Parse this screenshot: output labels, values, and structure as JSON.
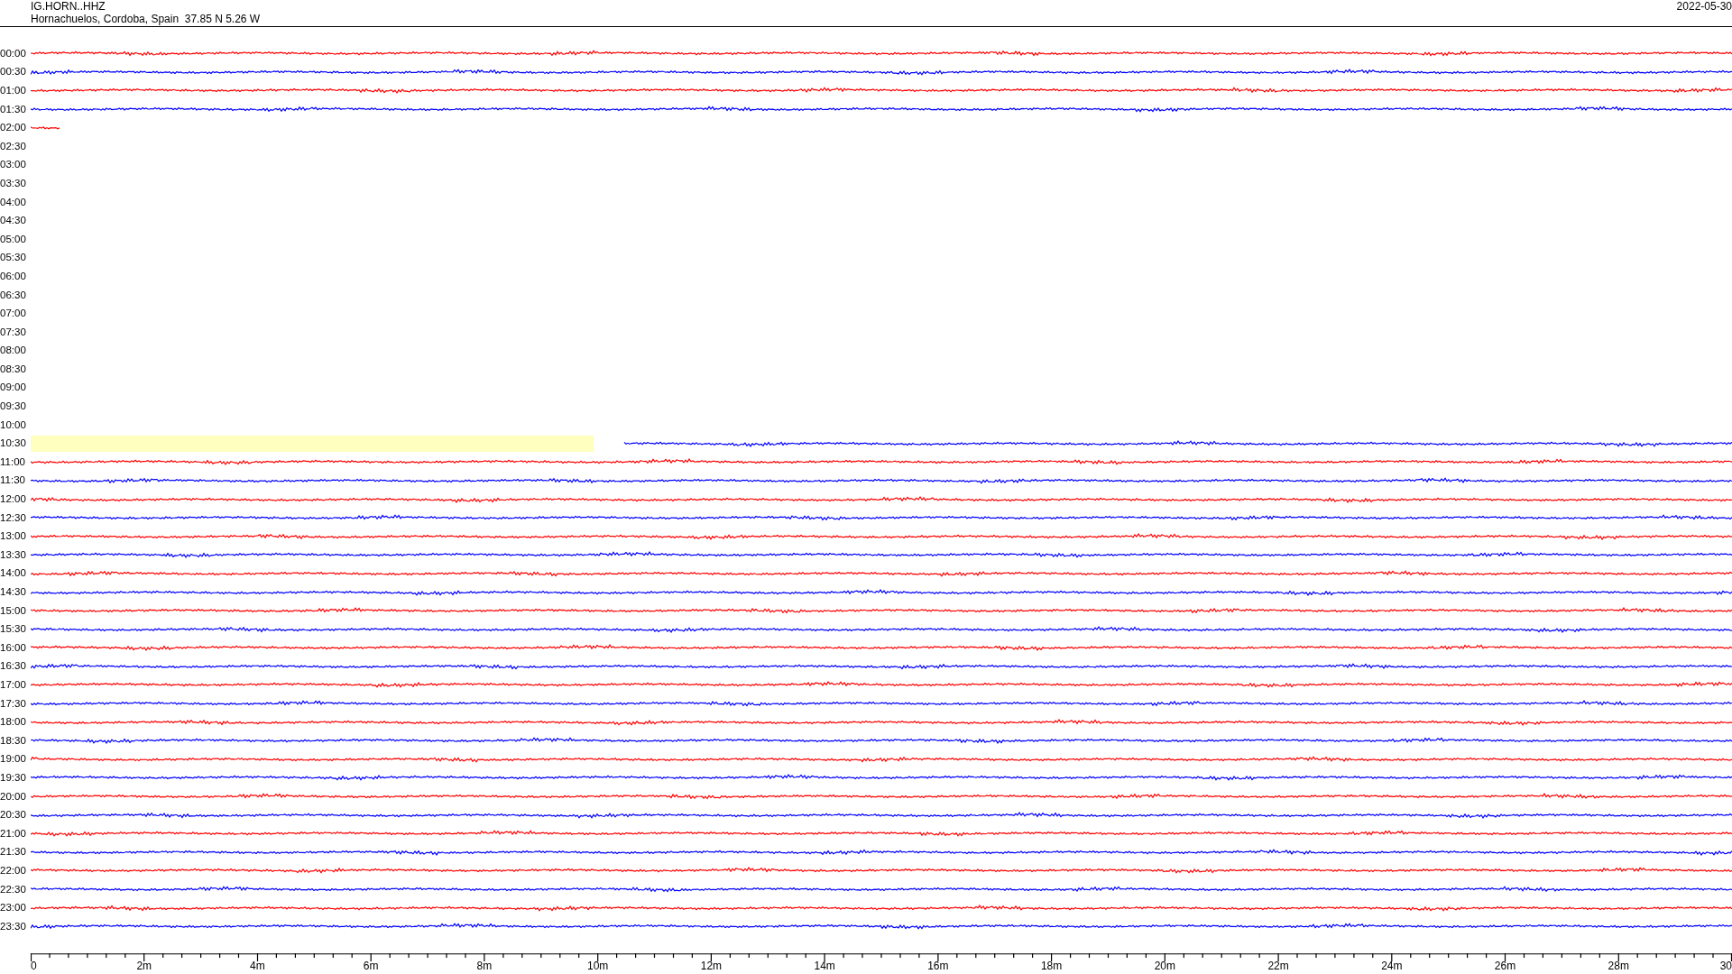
{
  "header": {
    "station": "IG.HORN..HHZ",
    "location": "Hornachuelos, Cordoba, Spain  37.85 N 5.26 W",
    "date": "2022-05-30"
  },
  "rows": [
    {
      "label": "00:00",
      "kind": "full",
      "color": "#ff0000"
    },
    {
      "label": "00:30",
      "kind": "full",
      "color": "#0000ff"
    },
    {
      "label": "01:00",
      "kind": "full",
      "color": "#ff0000"
    },
    {
      "label": "01:30",
      "kind": "full",
      "color": "#0000ff"
    },
    {
      "label": "02:00",
      "kind": "start",
      "color": "#ff0000"
    },
    {
      "label": "02:30",
      "kind": "none"
    },
    {
      "label": "03:00",
      "kind": "none"
    },
    {
      "label": "03:30",
      "kind": "none"
    },
    {
      "label": "04:00",
      "kind": "none"
    },
    {
      "label": "04:30",
      "kind": "none"
    },
    {
      "label": "05:00",
      "kind": "none"
    },
    {
      "label": "05:30",
      "kind": "none"
    },
    {
      "label": "06:00",
      "kind": "none"
    },
    {
      "label": "06:30",
      "kind": "none"
    },
    {
      "label": "07:00",
      "kind": "none"
    },
    {
      "label": "07:30",
      "kind": "none"
    },
    {
      "label": "08:00",
      "kind": "none"
    },
    {
      "label": "08:30",
      "kind": "none"
    },
    {
      "label": "09:00",
      "kind": "none"
    },
    {
      "label": "09:30",
      "kind": "none"
    },
    {
      "label": "10:00",
      "kind": "none"
    },
    {
      "label": "10:30",
      "kind": "gap-start",
      "color": "#0000ff"
    },
    {
      "label": "11:00",
      "kind": "full",
      "color": "#ff0000"
    },
    {
      "label": "11:30",
      "kind": "full",
      "color": "#0000ff"
    },
    {
      "label": "12:00",
      "kind": "full",
      "color": "#ff0000"
    },
    {
      "label": "12:30",
      "kind": "full",
      "color": "#0000ff"
    },
    {
      "label": "13:00",
      "kind": "full",
      "color": "#ff0000"
    },
    {
      "label": "13:30",
      "kind": "full",
      "color": "#0000ff"
    },
    {
      "label": "14:00",
      "kind": "full",
      "color": "#ff0000"
    },
    {
      "label": "14:30",
      "kind": "full",
      "color": "#0000ff"
    },
    {
      "label": "15:00",
      "kind": "full",
      "color": "#ff0000"
    },
    {
      "label": "15:30",
      "kind": "full",
      "color": "#0000ff"
    },
    {
      "label": "16:00",
      "kind": "full",
      "color": "#ff0000"
    },
    {
      "label": "16:30",
      "kind": "full",
      "color": "#0000ff"
    },
    {
      "label": "17:00",
      "kind": "full",
      "color": "#ff0000"
    },
    {
      "label": "17:30",
      "kind": "full",
      "color": "#0000ff"
    },
    {
      "label": "18:00",
      "kind": "full",
      "color": "#ff0000"
    },
    {
      "label": "18:30",
      "kind": "full",
      "color": "#0000ff"
    },
    {
      "label": "19:00",
      "kind": "full",
      "color": "#ff0000"
    },
    {
      "label": "19:30",
      "kind": "full",
      "color": "#0000ff"
    },
    {
      "label": "20:00",
      "kind": "full",
      "color": "#ff0000"
    },
    {
      "label": "20:30",
      "kind": "full",
      "color": "#0000ff"
    },
    {
      "label": "21:00",
      "kind": "full",
      "color": "#ff0000"
    },
    {
      "label": "21:30",
      "kind": "full",
      "color": "#0000ff"
    },
    {
      "label": "22:00",
      "kind": "full",
      "color": "#ff0000"
    },
    {
      "label": "22:30",
      "kind": "full",
      "color": "#0000ff"
    },
    {
      "label": "23:00",
      "kind": "full",
      "color": "#ff0000"
    },
    {
      "label": "23:30",
      "kind": "full",
      "color": "#0000ff"
    }
  ],
  "axis": {
    "ticks": [
      "0",
      "2m",
      "4m",
      "6m",
      "8m",
      "10m",
      "12m",
      "14m",
      "16m",
      "18m",
      "20m",
      "22m",
      "24m",
      "26m",
      "28m",
      "30"
    ]
  }
}
